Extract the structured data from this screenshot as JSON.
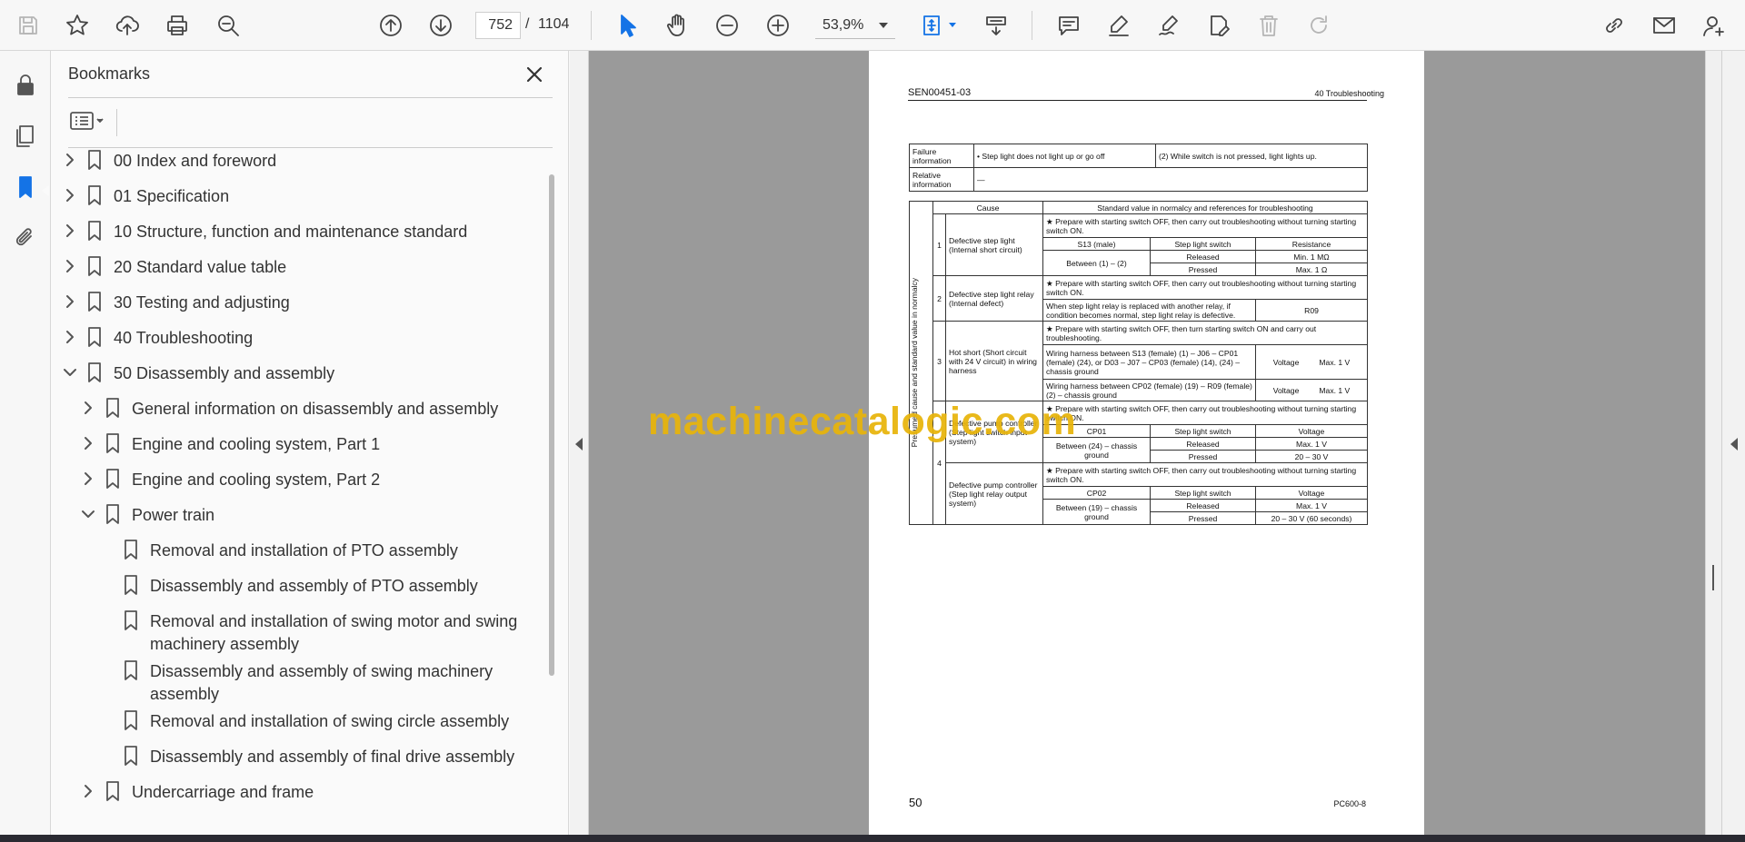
{
  "toolbar": {
    "icons": [
      "save-icon",
      "star-icon",
      "upload-icon",
      "print-icon",
      "zoom-search-icon",
      "arrow-up-icon",
      "arrow-down-icon",
      "select-cursor-icon",
      "hand-icon",
      "zoom-out-icon",
      "zoom-in-icon",
      "fit-page-icon",
      "scroll-mode-icon",
      "comment-icon",
      "highlight-icon",
      "sign-icon",
      "edit-icon",
      "trash-icon",
      "redo-icon",
      "share-link-icon",
      "mail-icon",
      "account-icon"
    ],
    "current_page": "752",
    "page_separator": "/",
    "total_pages": "1104",
    "zoom": "53,9%"
  },
  "bookmarks": {
    "title": "Bookmarks",
    "items": [
      {
        "label": "00 Index and foreword"
      },
      {
        "label": "01 Specification"
      },
      {
        "label": "10 Structure, function and maintenance standard"
      },
      {
        "label": "20 Standard value table"
      },
      {
        "label": "30 Testing and adjusting"
      },
      {
        "label": "40 Troubleshooting"
      },
      {
        "label": "50 Disassembly and assembly"
      },
      {
        "label": "General information on disassembly and assembly"
      },
      {
        "label": "Engine and cooling system, Part 1"
      },
      {
        "label": "Engine and cooling system, Part 2"
      },
      {
        "label": "Power train"
      },
      {
        "label": "Removal and installation of PTO assembly"
      },
      {
        "label": "Disassembly and assembly of PTO assembly"
      },
      {
        "label": "Removal and installation of swing motor and swing",
        "label2": "machinery assembly"
      },
      {
        "label": "Disassembly and assembly of swing machinery",
        "label2": "assembly"
      },
      {
        "label": "Removal and installation of swing circle assembly"
      },
      {
        "label": "Disassembly and assembly of final drive assembly"
      },
      {
        "label": "Undercarriage and frame"
      }
    ]
  },
  "document": {
    "header_left": "SEN00451-03",
    "header_right": "40 Troubleshooting",
    "failure_label": "Failure information",
    "failure_text": "• Step light does not light up or go off",
    "failure_condition": "(2) While switch is not pressed, light lights up.",
    "relative_label": "Relative information",
    "relative_text": "—",
    "side_label": "Presumed cause and standard value in normalcy",
    "col_cause": "Cause",
    "col_standard": "Standard value in normalcy and references for troubleshooting",
    "prep_off": "★ Prepare with starting switch OFF, then carry out troubleshooting without turning starting switch ON.",
    "prep_on": "★ Prepare with starting switch OFF, then turn starting switch ON and carry out troubleshooting.",
    "c1_num": "1",
    "c1_cause": "Defective step light (Internal short circuit)",
    "c1_h1": "S13 (male)",
    "c1_h2": "Step light switch",
    "c1_h3": "Resistance",
    "c1_between": "Between (1) – (2)",
    "released": "Released",
    "pressed": "Pressed",
    "c1_v1": "Min. 1 MΩ",
    "c1_v2": "Max. 1 Ω",
    "c2_num": "2",
    "c2_cause": "Defective step light relay (Internal defect)",
    "c2_text": "When step light relay is replaced with another relay, if condition becomes normal, step light relay is defective.",
    "c2_code": "R09",
    "c3_num": "3",
    "c3_cause": "Hot short (Short circuit with 24 V circuit) in wiring harness",
    "c3_h1": "Wiring harness between S13 (female) (1) – J06 – CP01 (female) (24), or D03 – J07 – CP03 (female) (14), (24) – chassis ground",
    "c3_h2": "Wiring harness between CP02 (female) (19) – R09 (female) (2) – chassis ground",
    "voltage": "Voltage",
    "max1v": "Max. 1 V",
    "c4_num": "4",
    "c4_cause1": "Defective pump controller (Step light switch input system)",
    "c4_cause2": "Defective pump controller (Step light relay output system)",
    "cp01": "CP01",
    "cp02": "CP02",
    "between24": "Between (24) – chassis ground",
    "between19": "Between (19) – chassis ground",
    "v20_30": "20 – 30 V",
    "v20_30_60": "20 – 30 V (60 seconds)",
    "footer_left": "50",
    "footer_right": "PC600-8"
  },
  "watermark": "machinecatalogic.com"
}
